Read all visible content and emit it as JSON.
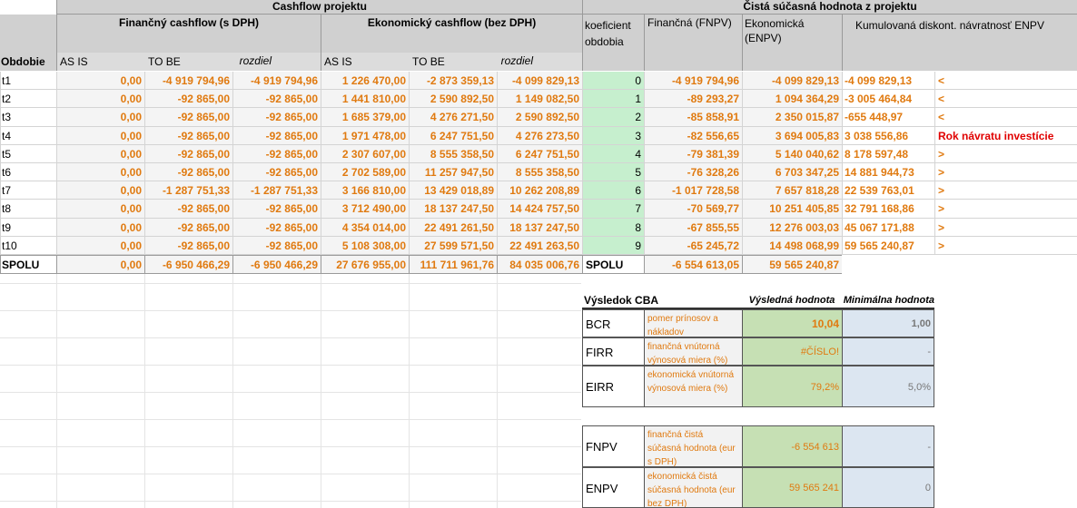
{
  "headers": {
    "cashflow": "Cashflow projektu",
    "cista": "Čistá súčasná hodnota z projektu",
    "financny": "Finančný cashflow (s DPH)",
    "ekonomicky": "Ekonomický cashflow (bez DPH)",
    "koeficient": "koeficient obdobia",
    "fnpv": "Finančná (FNPV)",
    "enpv": "Ekonomická (ENPV)",
    "kumul": "Kumulovaná diskont. návratnosť ENPV",
    "obdobie": "Obdobie",
    "as_is": "AS IS",
    "to_be": "TO BE",
    "rozdiel": "rozdiel"
  },
  "rows": [
    {
      "p": "t1",
      "f_asis": "0,00",
      "f_tobe": "-4 919 794,96",
      "f_roz": "-4 919 794,96",
      "e_asis": "1 226 470,00",
      "e_tobe": "-2 873 359,13",
      "e_roz": "-4 099 829,13",
      "k": "0",
      "fnpv": "-4 919 794,96",
      "enpv": "-4 099 829,13",
      "kum": "-4 099 829,13",
      "note": "<"
    },
    {
      "p": "t2",
      "f_asis": "0,00",
      "f_tobe": "-92 865,00",
      "f_roz": "-92 865,00",
      "e_asis": "1 441 810,00",
      "e_tobe": "2 590 892,50",
      "e_roz": "1 149 082,50",
      "k": "1",
      "fnpv": "-89 293,27",
      "enpv": "1 094 364,29",
      "kum": "-3 005 464,84",
      "note": "<"
    },
    {
      "p": "t3",
      "f_asis": "0,00",
      "f_tobe": "-92 865,00",
      "f_roz": "-92 865,00",
      "e_asis": "1 685 379,00",
      "e_tobe": "4 276 271,50",
      "e_roz": "2 590 892,50",
      "k": "2",
      "fnpv": "-85 858,91",
      "enpv": "2 350 015,87",
      "kum": "-655 448,97",
      "note": "<"
    },
    {
      "p": "t4",
      "f_asis": "0,00",
      "f_tobe": "-92 865,00",
      "f_roz": "-92 865,00",
      "e_asis": "1 971 478,00",
      "e_tobe": "6 247 751,50",
      "e_roz": "4 276 273,50",
      "k": "3",
      "fnpv": "-82 556,65",
      "enpv": "3 694 005,83",
      "kum": "3 038 556,86",
      "note": "Rok návratu investície"
    },
    {
      "p": "t5",
      "f_asis": "0,00",
      "f_tobe": "-92 865,00",
      "f_roz": "-92 865,00",
      "e_asis": "2 307 607,00",
      "e_tobe": "8 555 358,50",
      "e_roz": "6 247 751,50",
      "k": "4",
      "fnpv": "-79 381,39",
      "enpv": "5 140 040,62",
      "kum": "8 178 597,48",
      "note": ">"
    },
    {
      "p": "t6",
      "f_asis": "0,00",
      "f_tobe": "-92 865,00",
      "f_roz": "-92 865,00",
      "e_asis": "2 702 589,00",
      "e_tobe": "11 257 947,50",
      "e_roz": "8 555 358,50",
      "k": "5",
      "fnpv": "-76 328,26",
      "enpv": "6 703 347,25",
      "kum": "14 881 944,73",
      "note": ">"
    },
    {
      "p": "t7",
      "f_asis": "0,00",
      "f_tobe": "-1 287 751,33",
      "f_roz": "-1 287 751,33",
      "e_asis": "3 166 810,00",
      "e_tobe": "13 429 018,89",
      "e_roz": "10 262 208,89",
      "k": "6",
      "fnpv": "-1 017 728,58",
      "enpv": "7 657 818,28",
      "kum": "22 539 763,01",
      "note": ">"
    },
    {
      "p": "t8",
      "f_asis": "0,00",
      "f_tobe": "-92 865,00",
      "f_roz": "-92 865,00",
      "e_asis": "3 712 490,00",
      "e_tobe": "18 137 247,50",
      "e_roz": "14 424 757,50",
      "k": "7",
      "fnpv": "-70 569,77",
      "enpv": "10 251 405,85",
      "kum": "32 791 168,86",
      "note": ">"
    },
    {
      "p": "t9",
      "f_asis": "0,00",
      "f_tobe": "-92 865,00",
      "f_roz": "-92 865,00",
      "e_asis": "4 354 014,00",
      "e_tobe": "22 491 261,50",
      "e_roz": "18 137 247,50",
      "k": "8",
      "fnpv": "-67 855,55",
      "enpv": "12 276 003,03",
      "kum": "45 067 171,88",
      "note": ">"
    },
    {
      "p": "t10",
      "f_asis": "0,00",
      "f_tobe": "-92 865,00",
      "f_roz": "-92 865,00",
      "e_asis": "5 108 308,00",
      "e_tobe": "27 599 571,50",
      "e_roz": "22 491 263,50",
      "k": "9",
      "fnpv": "-65 245,72",
      "enpv": "14 498 068,99",
      "kum": "59 565 240,87",
      "note": ">"
    }
  ],
  "total": {
    "p": "SPOLU",
    "f_asis": "0,00",
    "f_tobe": "-6 950 466,29",
    "f_roz": "-6 950 466,29",
    "e_asis": "27 676 955,00",
    "e_tobe": "111 711 961,76",
    "e_roz": "84 035 006,76",
    "k": "SPOLU",
    "fnpv": "-6 554 613,05",
    "enpv": "59 565 240,87"
  },
  "cba": {
    "title": "Výsledok CBA",
    "col_result": "Výsledná hodnota",
    "col_min": "Minimálna hodnota",
    "items": [
      {
        "name": "BCR",
        "desc": "pomer prínosov a nákladov",
        "value": "10,04",
        "min": "1,00"
      },
      {
        "name": "FIRR",
        "desc": "finančná vnútorná výnosová miera (%)",
        "value": "#ČÍSLO!",
        "min": "-"
      },
      {
        "name": "EIRR",
        "desc": "ekonomická vnútorná výnosová miera (%)",
        "value": "79,2%",
        "min": "5,0%"
      },
      {
        "name": "FNPV",
        "desc": "finančná čistá súčasná hodnota (eur s DPH)",
        "value": "-6 554 613",
        "min": "-"
      },
      {
        "name": "ENPV",
        "desc": "ekonomická čistá súčasná hodnota (eur bez DPH)",
        "value": "59 565 241",
        "min": "0"
      }
    ]
  }
}
